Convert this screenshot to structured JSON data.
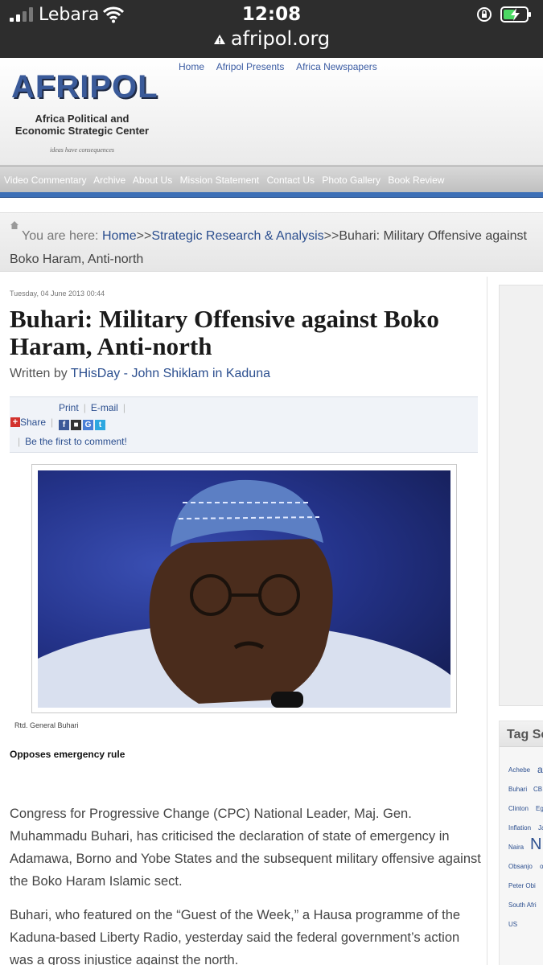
{
  "status_bar": {
    "carrier": "Lebara",
    "time": "12:08"
  },
  "url_bar": {
    "url": "afripol.org"
  },
  "site": {
    "logo_word": "AFRIPOL",
    "logo_subtitle_line1": "Africa Political and",
    "logo_subtitle_line2": "Economic Strategic Center",
    "logo_tagline": "ideas have consequences",
    "top_nav": [
      "Home",
      "Afripol Presents",
      "Africa Newspapers"
    ],
    "main_nav": [
      "Video Commentary",
      "Archive",
      "About Us",
      "Mission Statement",
      "Contact Us",
      "Photo Gallery",
      "Book Review"
    ]
  },
  "breadcrumb": {
    "prefix": "You are here:",
    "items": [
      "Home",
      "Strategic Research & Analysis",
      "Buhari: Military Offensive against Boko Haram, Anti-north"
    ],
    "separator": ">>"
  },
  "article": {
    "date": "Tuesday, 04 June 2013 00:44",
    "title": "Buhari: Military Offensive against Boko Haram, Anti-north",
    "byline_prefix": "Written by",
    "author": "THisDay - John Shiklam in Kaduna",
    "tools": {
      "print": "Print",
      "email": "E-mail",
      "share": "Share",
      "comment": "Be the first to comment!"
    },
    "image_caption": "Rtd. General Buhari",
    "subheading": "Opposes emergency rule",
    "paragraphs": [
      "Congress for Progressive Change (CPC) National Leader, Maj. Gen. Muhammadu Buhari, has criticised the declaration of state of emergency in Adamawa, Borno and Yobe States and the subsequent military offensive against the Boko Haram Islamic sect.",
      "Buhari, who featured on the “Guest of the Week,” a Hausa programme of the Kaduna-based Liberty Radio, yesterday said the federal government’s action was a gross injustice against the north."
    ]
  },
  "sidebar": {
    "tag_heading": "Tag Se",
    "tags": [
      "Achebe",
      "a",
      "Buhari",
      "CB",
      "Clinton",
      "Eg",
      "Inflation",
      "Ja",
      "Naira",
      "N",
      "Obsanjo",
      "o",
      "Peter Obi",
      "South Afri",
      "US"
    ]
  },
  "colors": {
    "status_bar_bg": "#2d2d2d",
    "link_blue": "#2c4f8f",
    "nav_band_blue": "#3d6fb6",
    "logo_blue": "#3a5a99"
  }
}
